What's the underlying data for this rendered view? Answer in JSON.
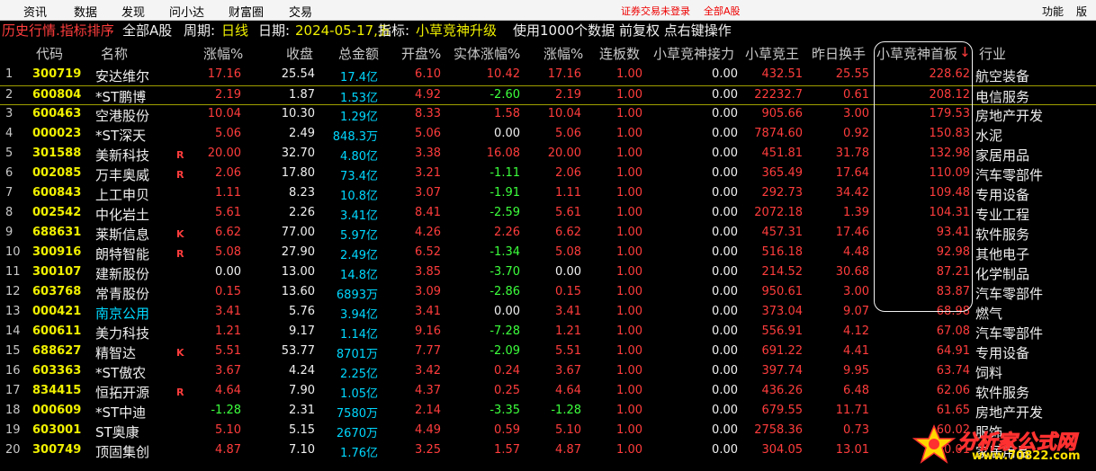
{
  "menu": {
    "items": [
      "资讯",
      "数据",
      "发现",
      "问小达",
      "财富圈",
      "交易"
    ],
    "login_status": "证券交易未登录",
    "market": "全部A股",
    "func_label": "功能",
    "layout_label": "版面"
  },
  "info": {
    "history": "历史行情.指标排序",
    "scope": "全部A股",
    "period_label": "周期:",
    "period_value": "日线",
    "date_label": "日期:",
    "date_value": "2024-05-17,五",
    "indicator_label": "指标:",
    "indicator_value": "小草竞神升级",
    "tail": "使用1000个数据 前复权 点右键操作"
  },
  "columns": {
    "code": "代码",
    "name": "名称",
    "pct": "涨幅%",
    "close": "收盘",
    "mktcap": "总金额",
    "open_pct": "开盘%",
    "body_pct": "实体涨幅%",
    "pct2": "涨幅%",
    "boards": "连板数",
    "relay": "小草竞神接力",
    "king": "小草竞王",
    "turnover": "昨日换手",
    "first_board": "小草竞神首板",
    "sort_arrow": "↓",
    "industry": "行业"
  },
  "rows": [
    {
      "idx": "1",
      "code": "300719",
      "name": "安达维尔",
      "flag": "",
      "pct": "17.16",
      "close": "25.54",
      "amt": "17.4亿",
      "open": "6.10",
      "body": "10.42",
      "pct2": "17.16",
      "boards": "1.00",
      "relay": "0.00",
      "king": "432.51",
      "turnover": "25.55",
      "first": "228.62",
      "industry": "航空装备"
    },
    {
      "idx": "2",
      "code": "600804",
      "name": "*ST鹏博",
      "flag": "",
      "pct": "2.19",
      "close": "1.87",
      "amt": "1.53亿",
      "open": "4.92",
      "body": "-2.60",
      "pct2": "2.19",
      "boards": "1.00",
      "relay": "0.00",
      "king": "22232.7",
      "turnover": "0.61",
      "first": "208.12",
      "industry": "电信服务"
    },
    {
      "idx": "3",
      "code": "600463",
      "name": "空港股份",
      "flag": "",
      "pct": "10.04",
      "close": "10.30",
      "amt": "1.29亿",
      "open": "8.33",
      "body": "1.58",
      "pct2": "10.04",
      "boards": "1.00",
      "relay": "0.00",
      "king": "905.66",
      "turnover": "3.00",
      "first": "179.53",
      "industry": "房地产开发"
    },
    {
      "idx": "4",
      "code": "000023",
      "name": "*ST深天",
      "flag": "",
      "pct": "5.06",
      "close": "2.49",
      "amt": "848.3万",
      "open": "5.06",
      "body": "0.00",
      "pct2": "5.06",
      "boards": "1.00",
      "relay": "0.00",
      "king": "7874.60",
      "turnover": "0.92",
      "first": "150.83",
      "industry": "水泥"
    },
    {
      "idx": "5",
      "code": "301588",
      "name": "美新科技",
      "flag": "R",
      "pct": "20.00",
      "close": "32.70",
      "amt": "4.80亿",
      "open": "3.38",
      "body": "16.08",
      "pct2": "20.00",
      "boards": "1.00",
      "relay": "0.00",
      "king": "451.81",
      "turnover": "31.78",
      "first": "132.98",
      "industry": "家居用品"
    },
    {
      "idx": "6",
      "code": "002085",
      "name": "万丰奥威",
      "flag": "R",
      "pct": "2.06",
      "close": "17.80",
      "amt": "73.4亿",
      "open": "3.21",
      "body": "-1.11",
      "pct2": "2.06",
      "boards": "1.00",
      "relay": "0.00",
      "king": "365.49",
      "turnover": "17.64",
      "first": "110.09",
      "industry": "汽车零部件"
    },
    {
      "idx": "7",
      "code": "600843",
      "name": "上工申贝",
      "flag": "",
      "pct": "1.11",
      "close": "8.23",
      "amt": "10.8亿",
      "open": "3.07",
      "body": "-1.91",
      "pct2": "1.11",
      "boards": "1.00",
      "relay": "0.00",
      "king": "292.73",
      "turnover": "34.42",
      "first": "109.48",
      "industry": "专用设备"
    },
    {
      "idx": "8",
      "code": "002542",
      "name": "中化岩土",
      "flag": "",
      "pct": "5.61",
      "close": "2.26",
      "amt": "3.41亿",
      "open": "8.41",
      "body": "-2.59",
      "pct2": "5.61",
      "boards": "1.00",
      "relay": "0.00",
      "king": "2072.18",
      "turnover": "1.39",
      "first": "104.31",
      "industry": "专业工程"
    },
    {
      "idx": "9",
      "code": "688631",
      "name": "莱斯信息",
      "flag": "K",
      "pct": "6.62",
      "close": "77.00",
      "amt": "5.97亿",
      "open": "4.26",
      "body": "2.26",
      "pct2": "6.62",
      "boards": "1.00",
      "relay": "0.00",
      "king": "457.31",
      "turnover": "17.46",
      "first": "93.41",
      "industry": "软件服务"
    },
    {
      "idx": "10",
      "code": "300916",
      "name": "朗特智能",
      "flag": "R",
      "pct": "5.08",
      "close": "27.90",
      "amt": "2.49亿",
      "open": "6.52",
      "body": "-1.34",
      "pct2": "5.08",
      "boards": "1.00",
      "relay": "0.00",
      "king": "516.18",
      "turnover": "4.48",
      "first": "92.98",
      "industry": "其他电子"
    },
    {
      "idx": "11",
      "code": "300107",
      "name": "建新股份",
      "flag": "",
      "pct": "0.00",
      "close": "13.00",
      "amt": "14.8亿",
      "open": "3.85",
      "body": "-3.70",
      "pct2": "0.00",
      "boards": "1.00",
      "relay": "0.00",
      "king": "214.52",
      "turnover": "30.68",
      "first": "87.21",
      "industry": "化学制品"
    },
    {
      "idx": "12",
      "code": "603768",
      "name": "常青股份",
      "flag": "",
      "pct": "0.15",
      "close": "13.60",
      "amt": "6893万",
      "open": "3.09",
      "body": "-2.86",
      "pct2": "0.15",
      "boards": "1.00",
      "relay": "0.00",
      "king": "950.61",
      "turnover": "3.00",
      "first": "83.87",
      "industry": "汽车零部件"
    },
    {
      "idx": "13",
      "code": "000421",
      "name": "南京公用",
      "flag": "",
      "pct": "3.41",
      "close": "5.76",
      "amt": "3.94亿",
      "open": "3.41",
      "body": "0.00",
      "pct2": "3.41",
      "boards": "1.00",
      "relay": "0.00",
      "king": "373.04",
      "turnover": "9.07",
      "first": "68.98",
      "industry": "燃气"
    },
    {
      "idx": "14",
      "code": "600611",
      "name": "美力科技",
      "flag": "",
      "pct": "1.21",
      "close": "9.17",
      "amt": "1.14亿",
      "open": "9.16",
      "body": "-7.28",
      "pct2": "1.21",
      "boards": "1.00",
      "relay": "0.00",
      "king": "556.91",
      "turnover": "4.12",
      "first": "67.08",
      "industry": "汽车零部件"
    },
    {
      "idx": "15",
      "code": "688627",
      "name": "精智达",
      "flag": "K",
      "pct": "5.51",
      "close": "53.77",
      "amt": "8701万",
      "open": "7.77",
      "body": "-2.09",
      "pct2": "5.51",
      "boards": "1.00",
      "relay": "0.00",
      "king": "691.22",
      "turnover": "4.41",
      "first": "64.91",
      "industry": "专用设备"
    },
    {
      "idx": "16",
      "code": "603363",
      "name": "*ST傲农",
      "flag": "",
      "pct": "3.67",
      "close": "4.24",
      "amt": "2.25亿",
      "open": "3.42",
      "body": "0.24",
      "pct2": "3.67",
      "boards": "1.00",
      "relay": "0.00",
      "king": "397.74",
      "turnover": "9.95",
      "first": "63.74",
      "industry": "饲料"
    },
    {
      "idx": "17",
      "code": "834415",
      "name": "恒拓开源",
      "flag": "R",
      "pct": "4.64",
      "close": "7.90",
      "amt": "1.05亿",
      "open": "4.37",
      "body": "0.25",
      "pct2": "4.64",
      "boards": "1.00",
      "relay": "0.00",
      "king": "436.26",
      "turnover": "6.48",
      "first": "62.06",
      "industry": "软件服务"
    },
    {
      "idx": "18",
      "code": "000609",
      "name": "*ST中迪",
      "flag": "",
      "pct": "-1.28",
      "close": "2.31",
      "amt": "7580万",
      "open": "2.14",
      "body": "-3.35",
      "pct2": "-1.28",
      "boards": "1.00",
      "relay": "0.00",
      "king": "679.55",
      "turnover": "11.71",
      "first": "61.65",
      "industry": "房地产开发"
    },
    {
      "idx": "19",
      "code": "603001",
      "name": "ST奥康",
      "flag": "",
      "pct": "5.10",
      "close": "5.15",
      "amt": "2670万",
      "open": "4.49",
      "body": "0.59",
      "pct2": "5.10",
      "boards": "1.00",
      "relay": "0.00",
      "king": "2758.36",
      "turnover": "0.73",
      "first": "60.02",
      "industry": "服饰"
    },
    {
      "idx": "20",
      "code": "300749",
      "name": "顶固集创",
      "flag": "",
      "pct": "4.87",
      "close": "7.10",
      "amt": "1.76亿",
      "open": "3.25",
      "body": "1.57",
      "pct2": "4.87",
      "boards": "1.00",
      "relay": "0.00",
      "king": "304.05",
      "turnover": "13.01",
      "first": "60.01",
      "industry": "家居用品"
    }
  ],
  "watermark": {
    "text": "分析家公式网",
    "url": "www.70822.com"
  }
}
